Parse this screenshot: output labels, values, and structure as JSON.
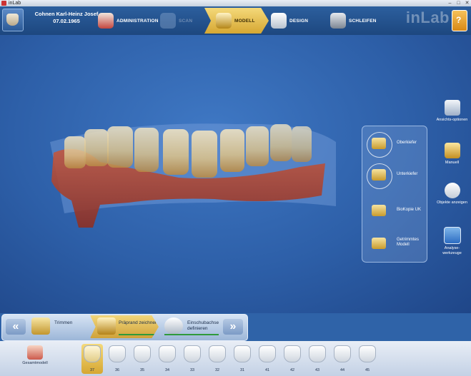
{
  "window": {
    "title": "inLab"
  },
  "header": {
    "patient_name": "Cohnen Karl-Heinz Josef",
    "patient_dob": "07.02.1965",
    "steps": [
      {
        "label": "ADMINISTRATION",
        "state": "enabled"
      },
      {
        "label": "SCAN",
        "state": "disabled"
      },
      {
        "label": "MODELL",
        "state": "active"
      },
      {
        "label": "DESIGN",
        "state": "enabled"
      },
      {
        "label": "SCHLEIFEN",
        "state": "enabled"
      }
    ],
    "brand": "inLab",
    "help_label": "?"
  },
  "model_panel": {
    "items": [
      {
        "label": "Oberkiefer",
        "icon": "upper-jaw-icon"
      },
      {
        "label": "Unterkiefer",
        "icon": "lower-jaw-icon"
      },
      {
        "label": "BioKopie UK",
        "icon": "biocopy-icon"
      },
      {
        "label": "Getrimmtes Modell",
        "icon": "trimmed-model-icon"
      }
    ]
  },
  "right_tools": [
    {
      "label": "Ansichts-optionen",
      "icon": "view-options-icon"
    },
    {
      "label": "Manuell",
      "icon": "manual-icon"
    },
    {
      "label": "Objekte anzeigen",
      "icon": "show-objects-icon"
    },
    {
      "label": "Analyse-werkzeuge",
      "icon": "analysis-tools-icon"
    }
  ],
  "workflow": {
    "prev_label": "«",
    "next_label": "»",
    "steps": [
      {
        "label": "Trimmen",
        "state": "done"
      },
      {
        "label": "Präprand zeichnen",
        "state": "active"
      },
      {
        "label": "Einschubachse definieren",
        "state": "pending"
      }
    ]
  },
  "toolbar": {
    "full_model_label": "Gesamtmodell",
    "teeth": [
      "37",
      "36",
      "35",
      "34",
      "33",
      "32",
      "31",
      "41",
      "42",
      "43",
      "44",
      "45"
    ],
    "active_tooth": "37"
  },
  "colors": {
    "accent_gold": "#d6a732",
    "header_blue": "#1d477f",
    "viewport_blue": "#2d5fa8",
    "progress_green": "#2f9a3b"
  }
}
